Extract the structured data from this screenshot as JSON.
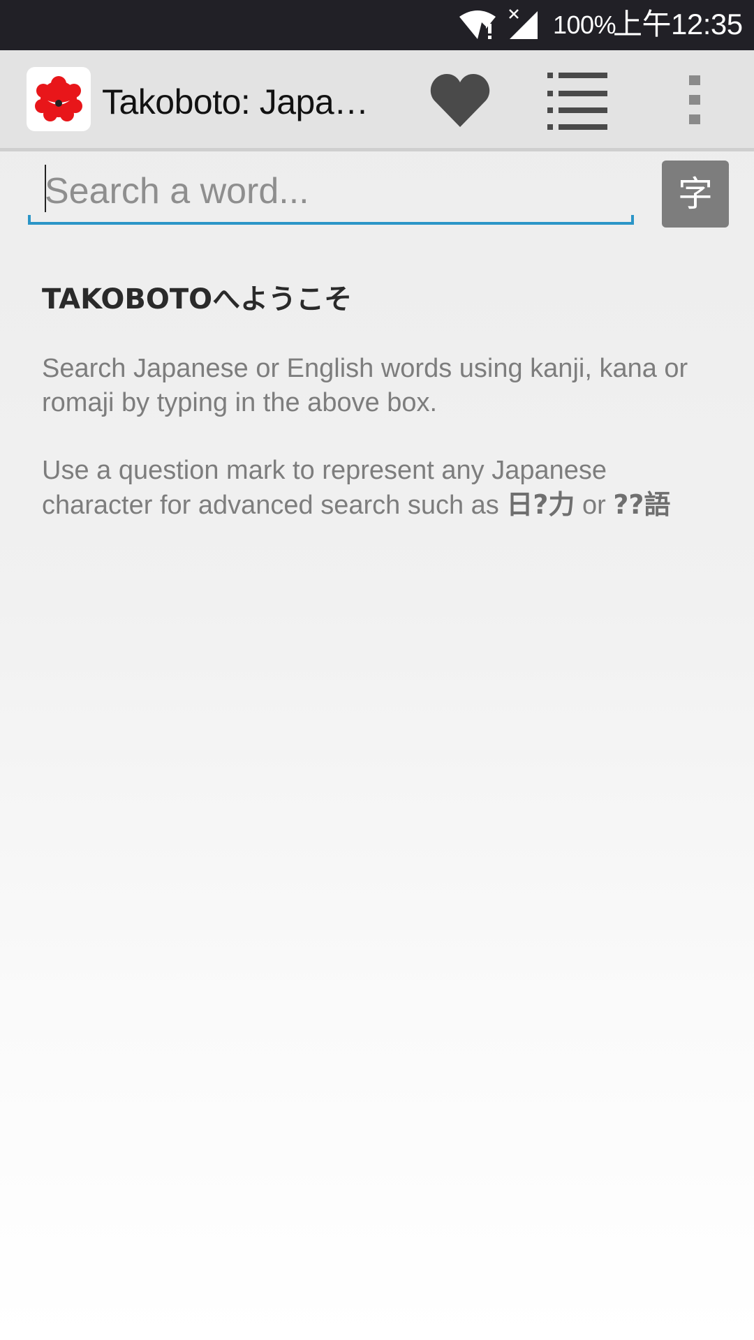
{
  "status_bar": {
    "battery": "100%",
    "time": "上午12:35",
    "wifi_icon": "wifi-alert-icon",
    "signal_icon": "cell-signal-no-data-icon"
  },
  "app_bar": {
    "title": "Takoboto: Japanese Dictionary",
    "logo_icon": "takoboto-octopus-logo",
    "favorites_icon": "heart-icon",
    "lists_icon": "list-icon",
    "overflow_icon": "more-vert-icon"
  },
  "search": {
    "placeholder": "Search a word...",
    "value": "",
    "kanji_button_label": "字",
    "accent_color": "#2b95c7"
  },
  "welcome": {
    "heading": "TAKOBOTOへようこそ",
    "para1": "Search Japanese or English words using kanji, kana or romaji by typing in the above box.",
    "para2_prefix": "Use a question mark to represent any Japanese character for advanced search such as ",
    "example1": "日?力",
    "connector": " or ",
    "example2": "??語"
  }
}
